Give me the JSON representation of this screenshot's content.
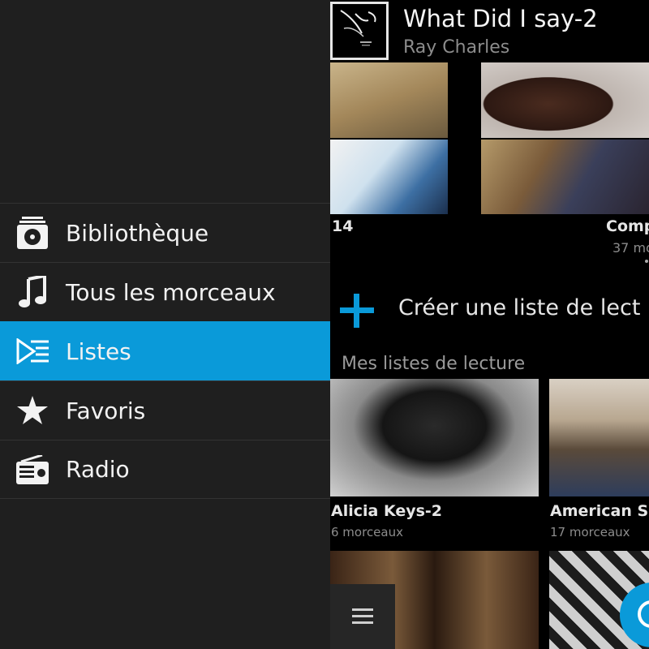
{
  "drawer": {
    "items": [
      {
        "label": "Bibliothèque",
        "icon": "library-icon",
        "active": false
      },
      {
        "label": "Tous les morceaux",
        "icon": "music-note-icon",
        "active": false
      },
      {
        "label": "Listes",
        "icon": "playlist-icon",
        "active": true
      },
      {
        "label": "Favoris",
        "icon": "star-icon",
        "active": false
      },
      {
        "label": "Radio",
        "icon": "radio-icon",
        "active": false
      }
    ]
  },
  "now_playing": {
    "title": "What Did I say-2",
    "artist": "Ray Charles"
  },
  "album_strip": {
    "left_label": "14",
    "right_label": "Comp",
    "right_count": "37 mo"
  },
  "create": {
    "label": "Créer une liste de lect"
  },
  "playlists": {
    "section_title": "Mes listes de lecture",
    "items": [
      {
        "name": "Alicia Keys-2",
        "count": "6 morceaux"
      },
      {
        "name": "American So",
        "count": "17 morceaux"
      }
    ]
  },
  "colors": {
    "accent": "#0a9ad9",
    "drawer_bg": "#1f1f1f",
    "content_bg": "#000000"
  }
}
